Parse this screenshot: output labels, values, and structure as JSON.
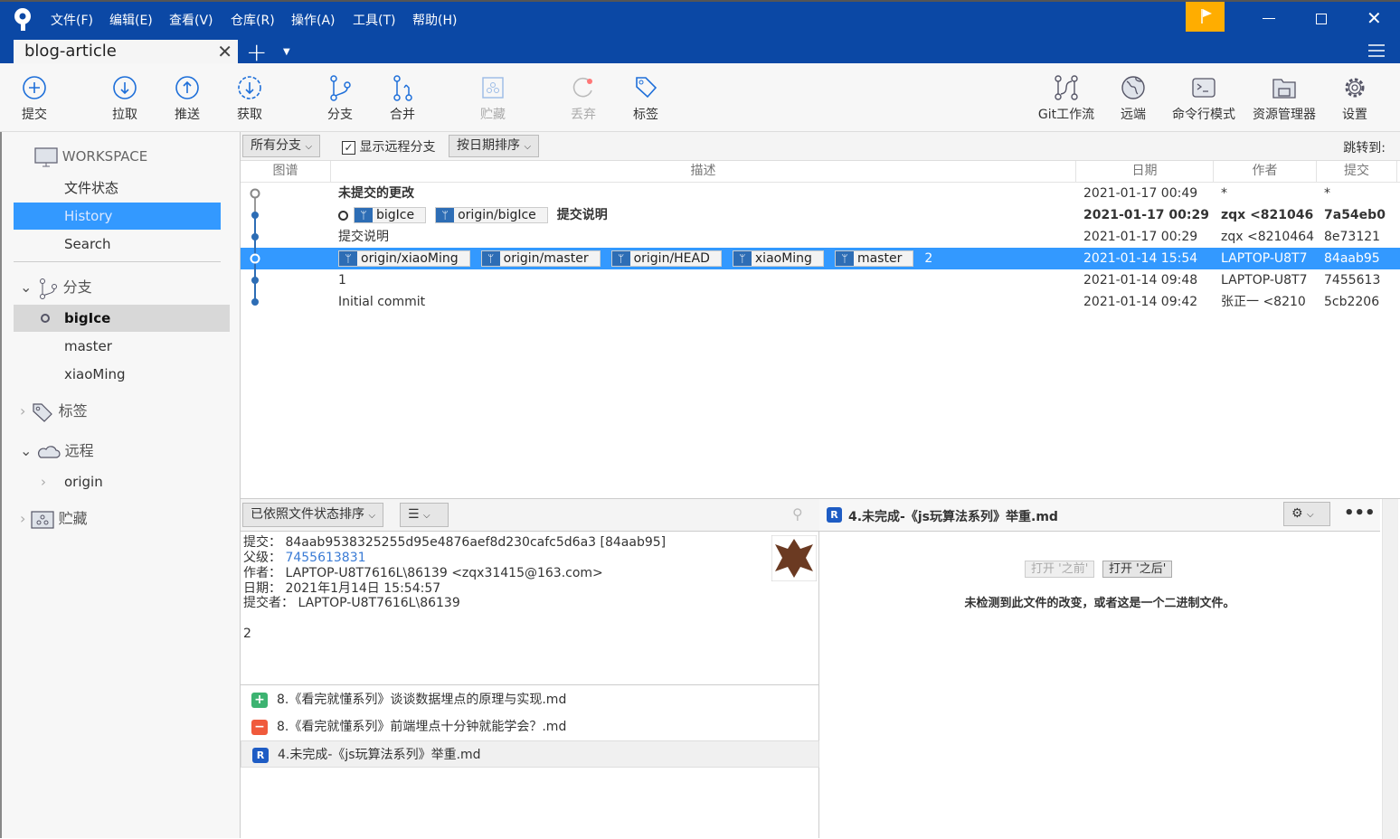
{
  "menu": [
    "文件(F)",
    "编辑(E)",
    "查看(V)",
    "仓库(R)",
    "操作(A)",
    "工具(T)",
    "帮助(H)"
  ],
  "tab": {
    "title": "blog-article"
  },
  "toolbar": {
    "commit": "提交",
    "pull": "拉取",
    "push": "推送",
    "fetch": "获取",
    "branch": "分支",
    "merge": "合并",
    "stash": "贮藏",
    "discard": "丢弃",
    "tag": "标签",
    "gitflow": "Git工作流",
    "remote": "远端",
    "terminal": "命令行模式",
    "explorer": "资源管理器",
    "settings": "设置"
  },
  "sidebar": {
    "workspace": "WORKSPACE",
    "file_status": "文件状态",
    "history": "History",
    "search": "Search",
    "branches": "分支",
    "branch_items": [
      "bigIce",
      "master",
      "xiaoMing"
    ],
    "tags": "标签",
    "remotes": "远程",
    "remote_items": [
      "origin"
    ],
    "stashes": "贮藏"
  },
  "filter": {
    "branches": "所有分支",
    "show_remote": "显示远程分支",
    "sort": "按日期排序",
    "jump": "跳转到:"
  },
  "columns": {
    "graph": "图谱",
    "desc": "描述",
    "date": "日期",
    "author": "作者",
    "commit": "提交"
  },
  "commits": [
    {
      "desc": "未提交的更改",
      "date": "2021-01-17 00:49",
      "author": "*",
      "hash": "*"
    },
    {
      "tags": [
        "bigIce",
        "origin/bigIce"
      ],
      "desc": "提交说明",
      "date": "2021-01-17 00:29",
      "author": "zqx <821046",
      "hash": "7a54eb0"
    },
    {
      "desc": "提交说明",
      "date": "2021-01-17 00:29",
      "author": "zqx <8210464",
      "hash": "8e73121"
    },
    {
      "tags": [
        "origin/xiaoMing",
        "origin/master",
        "origin/HEAD",
        "xiaoMing",
        "master"
      ],
      "desc": "2",
      "date": "2021-01-14 15:54",
      "author": "LAPTOP-U8T7",
      "hash": "84aab95"
    },
    {
      "desc": "1",
      "date": "2021-01-14 09:48",
      "author": "LAPTOP-U8T7",
      "hash": "7455613"
    },
    {
      "desc": "Initial commit",
      "date": "2021-01-14 09:42",
      "author": "张正一 <8210",
      "hash": "5cb2206"
    }
  ],
  "details": {
    "sort": "已依照文件状态排序",
    "commit_label": "提交：",
    "commit": "84aab9538325255d95e4876aef8d230cafc5d6a3 [84aab95]",
    "parent_label": "父级：",
    "parent": "7455613831",
    "author_label": "作者：",
    "author": "LAPTOP-U8T7616L\\86139 <zqx31415@163.com>",
    "date_label": "日期：",
    "date": "2021年1月14日 15:54:57",
    "committer_label": "提交者：",
    "committer": "LAPTOP-U8T7616L\\86139",
    "message": "2"
  },
  "files": [
    {
      "status": "added",
      "name": "8.《看完就懂系列》谈谈数据埋点的原理与实现.md"
    },
    {
      "status": "removed",
      "name": "8.《看完就懂系列》前端埋点十分钟就能学会？.md"
    },
    {
      "status": "renamed",
      "name": "4.未完成-《js玩算法系列》举重.md"
    }
  ],
  "diff": {
    "file": "4.未完成-《js玩算法系列》举重.md",
    "open_before": "打开 '之前'",
    "open_after": "打开 '之后'",
    "message": "未检测到此文件的改变，或者这是一个二进制文件。"
  },
  "colors": {
    "brand": "#0b48a5",
    "selection": "#3399ff",
    "flag": "#ffad00",
    "added": "#3cb371",
    "removed": "#f05a3c"
  }
}
